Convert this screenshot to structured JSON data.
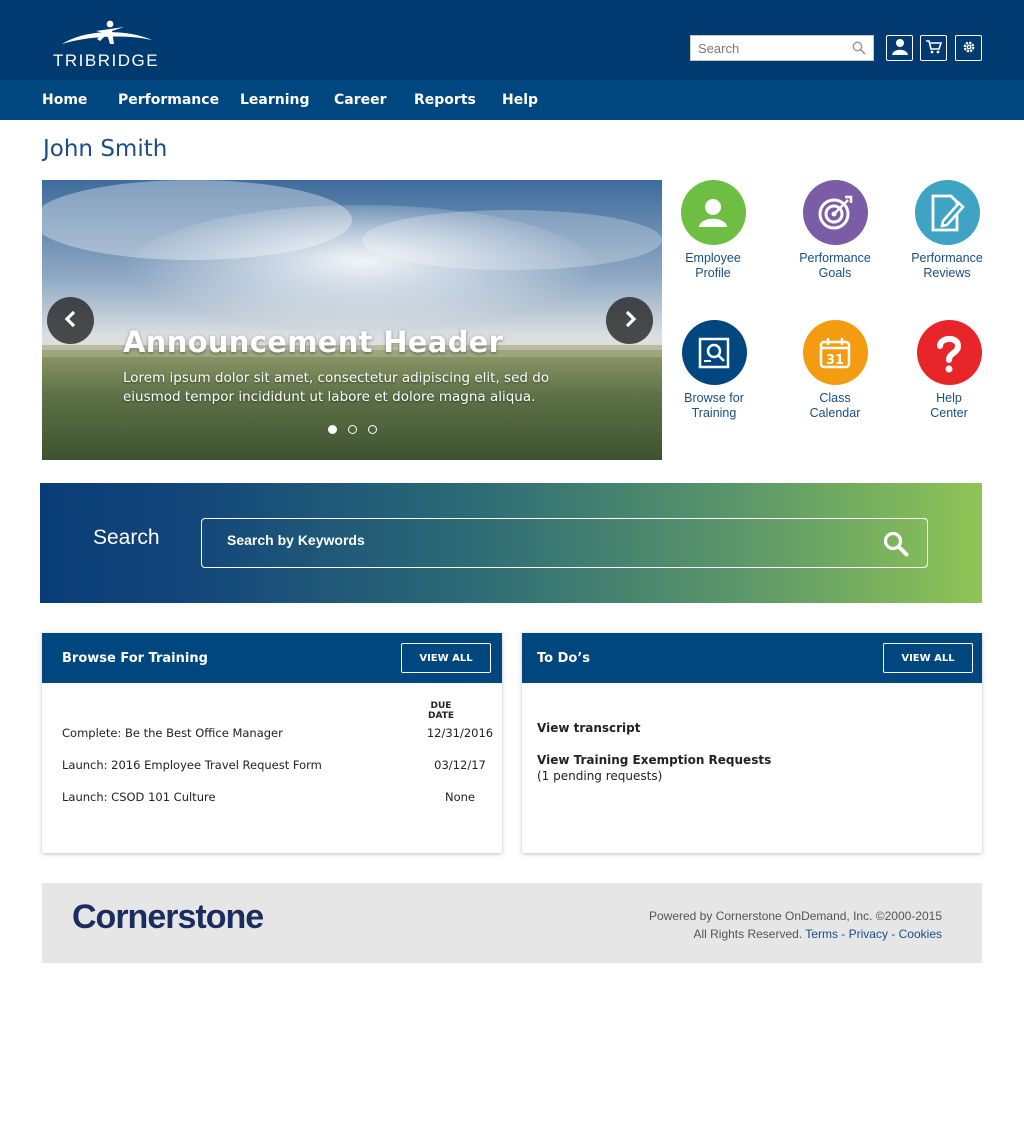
{
  "header": {
    "logo_text": "TRIBRIDGE",
    "search_placeholder": "Search",
    "icons": [
      "user-icon",
      "cart-icon",
      "gear-icon",
      "search-icon"
    ]
  },
  "nav": {
    "items": [
      {
        "label": "Home"
      },
      {
        "label": "Performance"
      },
      {
        "label": "Learning"
      },
      {
        "label": "Career"
      },
      {
        "label": "Reports"
      },
      {
        "label": "Help"
      }
    ]
  },
  "page": {
    "title": "John Smith"
  },
  "carousel": {
    "header": "Announcement Header",
    "text": "Lorem ipsum dolor sit amet, consectetur adipiscing elit, sed do eiusmod tempor incididunt ut labore et dolore magna aliqua.",
    "slide_count": 3,
    "active_slide": 1
  },
  "tiles": [
    {
      "label": "Employee\nProfile",
      "icon": "person-icon",
      "color": "#6fbe44"
    },
    {
      "label": "Performance\nGoals",
      "icon": "target-icon",
      "color": "#7a5da6"
    },
    {
      "label": "Performance\nReviews",
      "icon": "edit-document-icon",
      "color": "#3fa3c4"
    },
    {
      "label": "Browse for\nTraining",
      "icon": "browse-training-icon",
      "color": "#00467f"
    },
    {
      "label": "Class\nCalendar",
      "icon": "calendar-icon",
      "color": "#f39c12",
      "calendar_day": "31"
    },
    {
      "label": "Help\nCenter",
      "icon": "question-icon",
      "color": "#e8262a"
    }
  ],
  "search_band": {
    "label": "Search",
    "placeholder": "Search by Keywords"
  },
  "training_card": {
    "title": "Browse For Training",
    "view_all": "VIEW ALL",
    "due_header": "DUE DATE",
    "rows": [
      {
        "name": "Complete: Be the Best Office Manager",
        "due": "12/31/2016"
      },
      {
        "name": "Launch: 2016 Employee Travel Request Form",
        "due": "03/12/17"
      },
      {
        "name": "Launch: CSOD 101 Culture",
        "due": "None"
      }
    ]
  },
  "todo_card": {
    "title": "To Do’s",
    "view_all": "VIEW ALL",
    "items": [
      {
        "label": "View transcript",
        "sub": ""
      },
      {
        "label": "View Training Exemption Requests",
        "sub": "(1 pending requests)"
      }
    ]
  },
  "footer": {
    "brand": "Cornerstone",
    "powered": "Powered by Cornerstone OnDemand, Inc. ©2000-2015",
    "rights": "All Rights Reserved.",
    "links": [
      "Terms",
      "Privacy",
      "Cookies"
    ],
    "separator": " - "
  },
  "colors": {
    "header_bg": "#003a70",
    "nav_bg": "#00467f",
    "title_blue": "#1a4e86",
    "footer_bg": "#e6e6e6"
  }
}
